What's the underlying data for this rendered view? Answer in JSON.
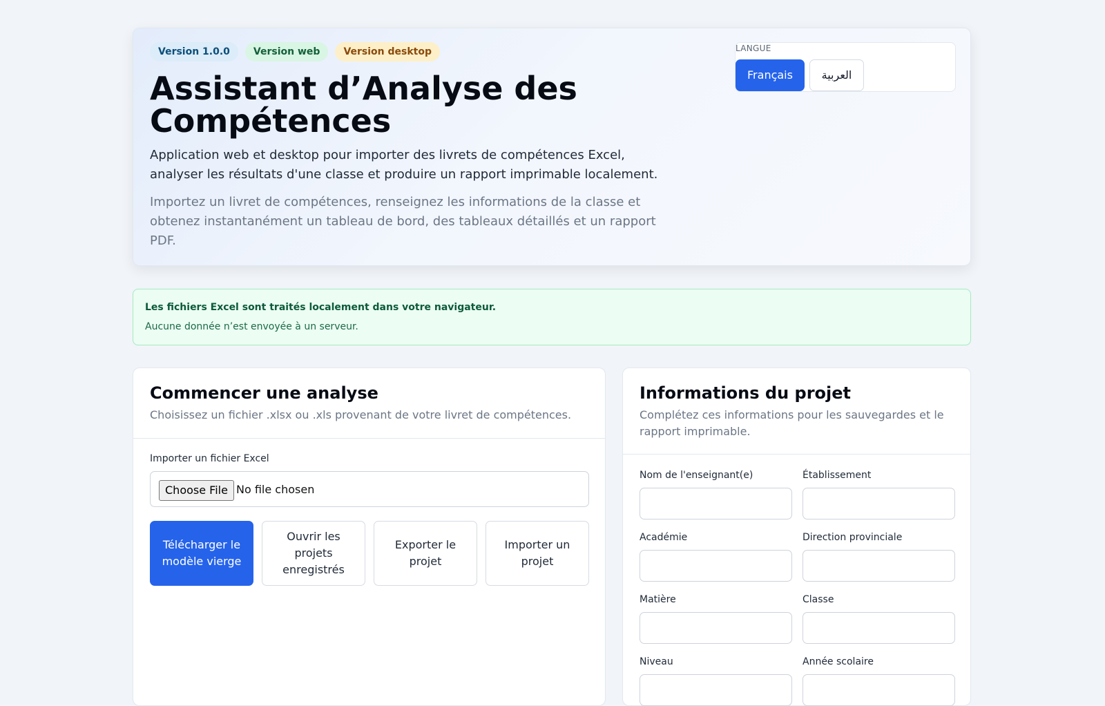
{
  "header": {
    "badges": [
      "Version 1.0.0",
      "Version web",
      "Version desktop"
    ],
    "title": "Assistant d’Analyse des Compétences",
    "lead": "Application web et desktop pour importer des livrets de compétences Excel, analyser les résultats d'une classe et produire un rapport imprimable localement.",
    "subtitle": "Importez un livret de compétences, renseignez les informations de la classe et obtenez instantanément un tableau de bord, des tableaux détaillés et un rapport PDF."
  },
  "language": {
    "label": "Langue",
    "options": [
      "Français",
      "العربية"
    ],
    "selected": "Français"
  },
  "notice": {
    "strong": "Les fichiers Excel sont traités localement dans votre navigateur.",
    "text": "Aucune donnée n’est envoyée à un serveur."
  },
  "start": {
    "title": "Commencer une analyse",
    "description": "Choisissez un fichier .xlsx ou .xls provenant de votre livret de compétences.",
    "file_label": "Importer un fichier Excel",
    "file_button": "Choose File",
    "file_status": "No file chosen",
    "actions": [
      "Télécharger le modèle vierge",
      "Ouvrir les projets enregistrés",
      "Exporter le projet",
      "Importer un projet"
    ]
  },
  "project": {
    "title": "Informations du projet",
    "description": "Complétez ces informations pour les sauvegardes et le rapport imprimable.",
    "fields": [
      {
        "label": "Nom de l'enseignant(e)",
        "value": ""
      },
      {
        "label": "Établissement",
        "value": ""
      },
      {
        "label": "Académie",
        "value": ""
      },
      {
        "label": "Direction provinciale",
        "value": ""
      },
      {
        "label": "Matière",
        "value": ""
      },
      {
        "label": "Classe",
        "value": ""
      },
      {
        "label": "Niveau",
        "value": ""
      },
      {
        "label": "Année scolaire",
        "value": ""
      }
    ]
  },
  "colors": {
    "accent": "#2563eb",
    "page_background": "#f1f4f8",
    "notice_background": "#ecfdf3",
    "notice_text": "#0c5a3a"
  }
}
